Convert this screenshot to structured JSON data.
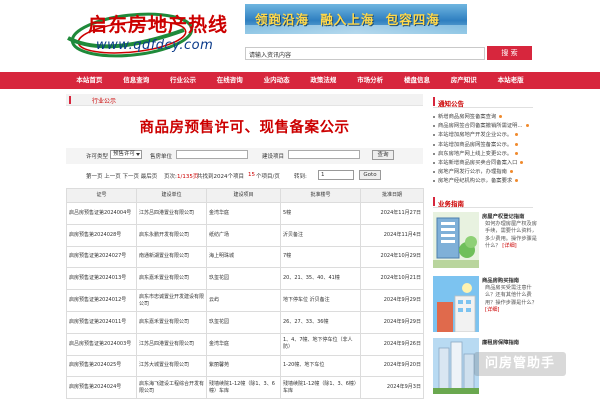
{
  "header": {
    "logo_text": "启东房地产热线",
    "logo_url": "www.qdfdcy.com",
    "banner_text": "领跑沿海  融入上海  包容四海",
    "search_placeholder": "请输入资讯内容",
    "search_button": "搜 索"
  },
  "nav": [
    "本站首页",
    "信息查询",
    "行业公示",
    "在线咨询",
    "业内动态",
    "政策法规",
    "市场分析",
    "楼盘信息",
    "房产知识",
    "本站老版"
  ],
  "breadcrumb": "行业公示",
  "title": "商品房预售许可、现售备案公示",
  "filter": {
    "type_label": "许可类型",
    "type_value": "预售许可",
    "unit_label": "售房单位",
    "project_label": "建设项目",
    "query_button": "查询"
  },
  "pager": {
    "nav_links": "第一页 上一页 下一页 最后页",
    "page_label": "页次:",
    "page_value": "1/135页",
    "total_text": "共找到2024个项目",
    "per_page_value": "15",
    "per_page_text": "个项目/页",
    "goto_label": "转到:",
    "goto_value": "1",
    "goto_button": "Goto"
  },
  "table": {
    "headers": [
      "证号",
      "建设单位",
      "建设项目",
      "批准楼号",
      "批准日期"
    ],
    "rows": [
      [
        "启吕房预售证第2024004号",
        "江苏吕四港置业有限公司",
        "金湾华庭",
        "5幢",
        "2024年11月27日"
      ],
      [
        "启房预售第2024028号",
        "启东永鹏开发有限公司",
        "纸纺广场",
        "沂贝备注",
        "2024年11月4日"
      ],
      [
        "启房预售证第2024027号",
        "南通新湖置业有限公司",
        "海上明珠城",
        "7幢",
        "2024年10月29日"
      ],
      [
        "启房预售证第2024013号",
        "启东嘉禾置业有限公司",
        "玖玺花园",
        "20、21、35、40、41幢",
        "2024年10月21日"
      ],
      [
        "启房预售证第2024012号",
        "启东市忠诚置业开发建设有限公司",
        "云屿",
        "地下停车位 沂贝备注",
        "2024年9月29日"
      ],
      [
        "启房预售证第2024011号",
        "启东嘉禾置业有限公司",
        "玖玺花园",
        "26、27、33、36幢",
        "2024年9月29日"
      ],
      [
        "启吕房预售证第2024003号",
        "江苏吕四港置业有限公司",
        "金湾华庭",
        "1、4、7幢、地下停车位（非人防）",
        "2024年9月26日"
      ],
      [
        "启房预售第2024025号",
        "江苏大城置业有限公司",
        "紫丽馨苑",
        "1-20幢、地下车位",
        "2024年9月20日"
      ],
      [
        "启房预售第2024024号",
        "启东海飞建设工程综合开发有限公司",
        "残墙续院1-12幢（除1、3、6幢）车库",
        "残墙续院1-12幢（除1、3、6幢）车库",
        "2024年9月3日"
      ]
    ]
  },
  "notice": {
    "title": "通知公告",
    "items": [
      "新增商品房网签备案查询",
      "商品房网签合同备案撤销所需证明...",
      "本站增加房地产开发企业公示。",
      "本站增加商品房网签备案公示。",
      "启东房地产网上线上变更公示。",
      "本站新增商品房买卖合同备案入口",
      "房地产网发行公示，办理指南",
      "房地产经纪机构公示，备案要求"
    ]
  },
  "guide": {
    "title": "业务指南",
    "items": [
      {
        "title": "房屋产权登记指南",
        "desc": "如何办理房屋产权及房手续，需要什么资料，多少费用。操作步骤是什么？",
        "more": "[详细]"
      },
      {
        "title": "商品房购买指南",
        "desc": "商品房买受需注意什么？还有其他什么费用？操作步骤是什么？",
        "more": "[详细]"
      },
      {
        "title": "廉租房保障指南",
        "desc": "",
        "more": ""
      }
    ]
  },
  "watermark": "问房管助手",
  "colors": {
    "brand_red": "#d7263d",
    "title_red": "#cc0000",
    "logo_blue": "#0a3a8a"
  }
}
